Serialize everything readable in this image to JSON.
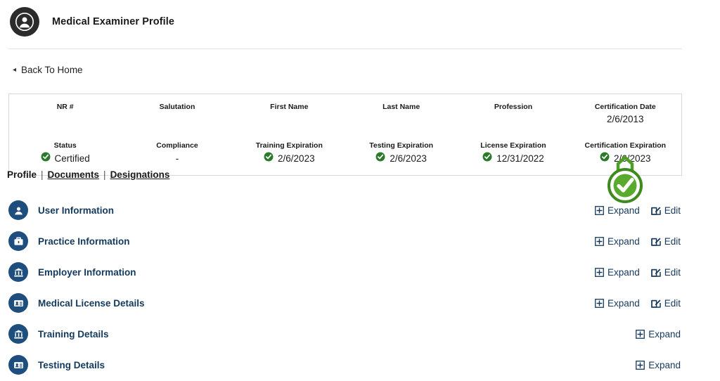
{
  "header": {
    "title": "Medical Examiner Profile",
    "avatar_icon": "user-circle-icon"
  },
  "back_link": {
    "label": "Back To Home",
    "caret": "◂"
  },
  "summary_card": {
    "row1": [
      {
        "label": "NR #",
        "value": ""
      },
      {
        "label": "Salutation",
        "value": ""
      },
      {
        "label": "First Name",
        "value": ""
      },
      {
        "label": "Last Name",
        "value": ""
      },
      {
        "label": "Profession",
        "value": ""
      },
      {
        "label": "Certification Date",
        "value": "2/6/2013"
      }
    ],
    "row2": [
      {
        "label": "Status",
        "value": "Certified",
        "status_icon": "check-circle-icon"
      },
      {
        "label": "Compliance",
        "value": "-",
        "status_icon": ""
      },
      {
        "label": "Training Expiration",
        "value": "2/6/2023",
        "status_icon": "check-circle-icon"
      },
      {
        "label": "Testing Expiration",
        "value": "2/6/2023",
        "status_icon": "check-circle-icon"
      },
      {
        "label": "License Expiration",
        "value": "12/31/2022",
        "status_icon": "check-circle-icon"
      },
      {
        "label": "Certification Expiration",
        "value": "2/6/2023",
        "status_icon": "check-circle-icon"
      }
    ]
  },
  "tabs": {
    "profile": "Profile",
    "documents": "Documents",
    "designations": "Designations",
    "separator": "|"
  },
  "cert_badge": {
    "icon": "certification-seal-icon",
    "color": "#4f9e27"
  },
  "actions": {
    "expand_label": "Expand",
    "edit_label": "Edit",
    "expand_icon": "plus-square-icon",
    "edit_icon": "pencil-square-icon"
  },
  "sections": [
    {
      "label": "User Information",
      "icon": "user-icon",
      "has_edit": true
    },
    {
      "label": "Practice Information",
      "icon": "briefcase-icon",
      "has_edit": true
    },
    {
      "label": "Employer Information",
      "icon": "bank-icon",
      "has_edit": true
    },
    {
      "label": "Medical License Details",
      "icon": "id-card-icon",
      "has_edit": true
    },
    {
      "label": "Training Details",
      "icon": "bank-icon",
      "has_edit": false
    },
    {
      "label": "Testing Details",
      "icon": "id-card-icon",
      "has_edit": false
    }
  ],
  "colors": {
    "navy": "#1d4e7e",
    "navy_text": "#13395c",
    "green_check": "#2a7a2a",
    "badge_green": "#4f9e27",
    "border": "#d8d8d8"
  }
}
